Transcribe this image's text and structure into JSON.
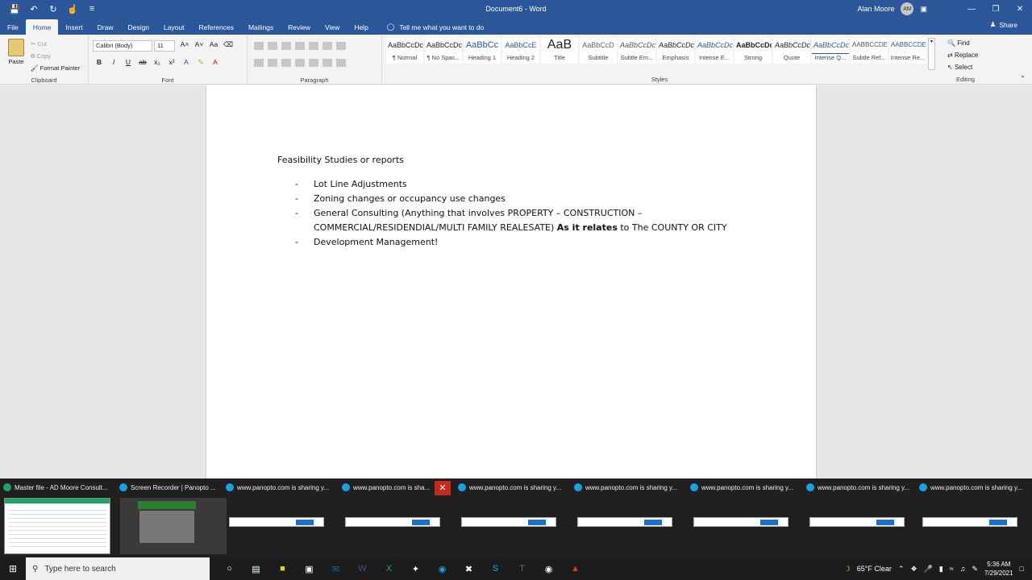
{
  "titlebar": {
    "document_title": "Document6 - Word",
    "user_name": "Alan Moore",
    "user_initials": "AM"
  },
  "tabs": [
    "File",
    "Home",
    "Insert",
    "Draw",
    "Design",
    "Layout",
    "References",
    "Mailings",
    "Review",
    "View",
    "Help"
  ],
  "tell_me": "Tell me what you want to do",
  "share": "Share",
  "clipboard": {
    "paste": "Paste",
    "cut": "Cut",
    "copy": "Copy",
    "format_painter": "Format Painter",
    "label": "Clipboard"
  },
  "font": {
    "name": "Calibri (Body)",
    "size": "11",
    "label": "Font"
  },
  "paragraph_label": "Paragraph",
  "styles": {
    "label": "Styles",
    "items": [
      {
        "preview": "AaBbCcDc",
        "name": "¶ Normal"
      },
      {
        "preview": "AaBbCcDc",
        "name": "¶ No Spac..."
      },
      {
        "preview": "AaBbCc",
        "name": "Heading 1"
      },
      {
        "preview": "AaBbCcE",
        "name": "Heading 2"
      },
      {
        "preview": "AaB",
        "name": "Title"
      },
      {
        "preview": "AaBbCcD",
        "name": "Subtitle"
      },
      {
        "preview": "AaBbCcDc",
        "name": "Subtle Em..."
      },
      {
        "preview": "AaBbCcDc",
        "name": "Emphasis"
      },
      {
        "preview": "AaBbCcDc",
        "name": "Intense E..."
      },
      {
        "preview": "AaBbCcDc",
        "name": "Strong"
      },
      {
        "preview": "AaBbCcDc",
        "name": "Quote"
      },
      {
        "preview": "AaBbCcDc",
        "name": "Intense Q..."
      },
      {
        "preview": "AABBCCDE",
        "name": "Subtle Ref..."
      },
      {
        "preview": "AABBCCDE",
        "name": "Intense Re..."
      }
    ]
  },
  "editing": {
    "find": "Find",
    "replace": "Replace",
    "select": "Select",
    "label": "Editing"
  },
  "document": {
    "heading": "Feasibility Studies or reports",
    "bullets": [
      {
        "dash": "-",
        "text": "Lot Line Adjustments"
      },
      {
        "dash": "-",
        "text": "Zoning changes or occupancy use changes"
      },
      {
        "dash": "-",
        "text_a": "General Consulting (Anything that involves PROPERTY – CONSTRUCTION – COMMERCIAL/RESIDENDIAL/MULTI FAMILY REALESATE) ",
        "text_bold": "As it relates",
        "text_b": " to The COUNTY OR CITY"
      },
      {
        "dash": "-",
        "text": "Development Management!"
      }
    ]
  },
  "thumbnails": [
    "Master file - AD Moore Consult...",
    "Screen Recorder | Panopto ...",
    "www.panopto.com is sharing y...",
    "www.panopto.com is sha...",
    "www.panopto.com is sharing y...",
    "www.panopto.com is sharing y...",
    "www.panopto.com is sharing y...",
    "www.panopto.com is sharing y...",
    "www.panopto.com is sharing y..."
  ],
  "taskbar": {
    "search_placeholder": "Type here to search",
    "weather": "65°F  Clear",
    "time": "5:36 AM",
    "date": "7/29/2021"
  }
}
